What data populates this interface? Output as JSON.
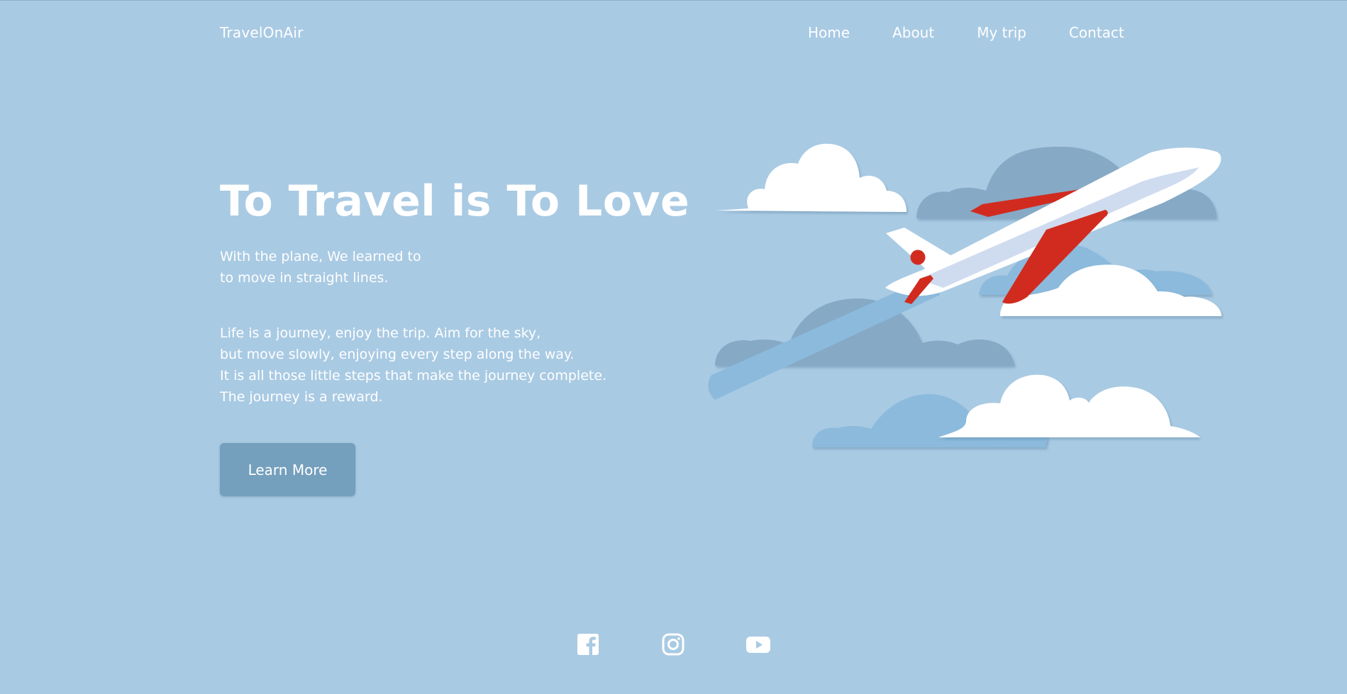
{
  "header": {
    "brand": "TravelOnAir",
    "nav": [
      {
        "label": "Home"
      },
      {
        "label": "About"
      },
      {
        "label": "My trip"
      },
      {
        "label": "Contact"
      }
    ]
  },
  "hero": {
    "title": "To Travel is To Love",
    "tagline_lines": [
      "With the plane, We learned to",
      "to move in straight lines."
    ],
    "body_lines": [
      "Life is a journey, enjoy the trip. Aim for the sky,",
      "but move slowly, enjoying every step along the way.",
      "It is all those little steps that make the journey complete.",
      "The journey is a reward."
    ],
    "cta_label": "Learn More"
  },
  "social": {
    "icons": [
      "facebook-icon",
      "instagram-icon",
      "youtube-icon"
    ]
  },
  "colors": {
    "background": "#a9cae3",
    "button": "#749fbd",
    "cloud_white": "#ffffff",
    "cloud_dark": "#86a9c6",
    "cloud_mid": "#8bbadc",
    "plane_red": "#d12b1f"
  }
}
